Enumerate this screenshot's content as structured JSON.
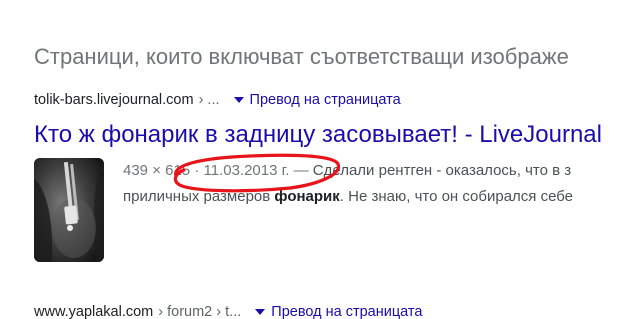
{
  "section_heading": "Страници, които включват съответстващи изображе",
  "results": [
    {
      "domain": "tolik-bars.livejournal.com",
      "path_sep": "› ...",
      "translate_label": "Превод на страницата",
      "title": "Кто ж фонарик в задницу засовывает! - LiveJournal",
      "meta_dimensions": "439 × 615",
      "meta_dot": "·",
      "meta_date": "11.03.2013 г.",
      "meta_dash": "—",
      "snippet_line1": "Сделали рентген - оказалось, что в з",
      "snippet_line2_before": "приличных размеров ",
      "snippet_line2_bold": "фонарик",
      "snippet_line2_after": ". Не знаю, что он собирался себе"
    },
    {
      "domain": "www.yaplakal.com",
      "path_sep": "› forum2 › t...",
      "translate_label": "Превод на страницата"
    }
  ],
  "annotation_color": "#e8141b",
  "link_color": "#1a0dab"
}
